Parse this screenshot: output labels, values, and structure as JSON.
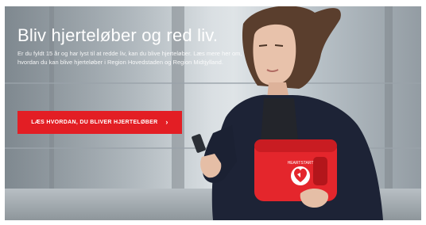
{
  "hero": {
    "headline": "Bliv hjerteløber og red liv.",
    "body": "Er du fyldt 15 år og har lyst til at redde liv, kan du blive hjerteløber. Læs mere her om, hvordan du kan blive hjerteløber i Region Hovedstaden og Region Midtjylland.",
    "cta_label": "LÆS HVORDAN, DU BLIVER HJERTELØBER",
    "cta_icon": "arrow-right-icon",
    "cta_color": "#e31e24"
  },
  "defibrillator": {
    "label": "HEARTSTART",
    "color": "#e4262c"
  }
}
